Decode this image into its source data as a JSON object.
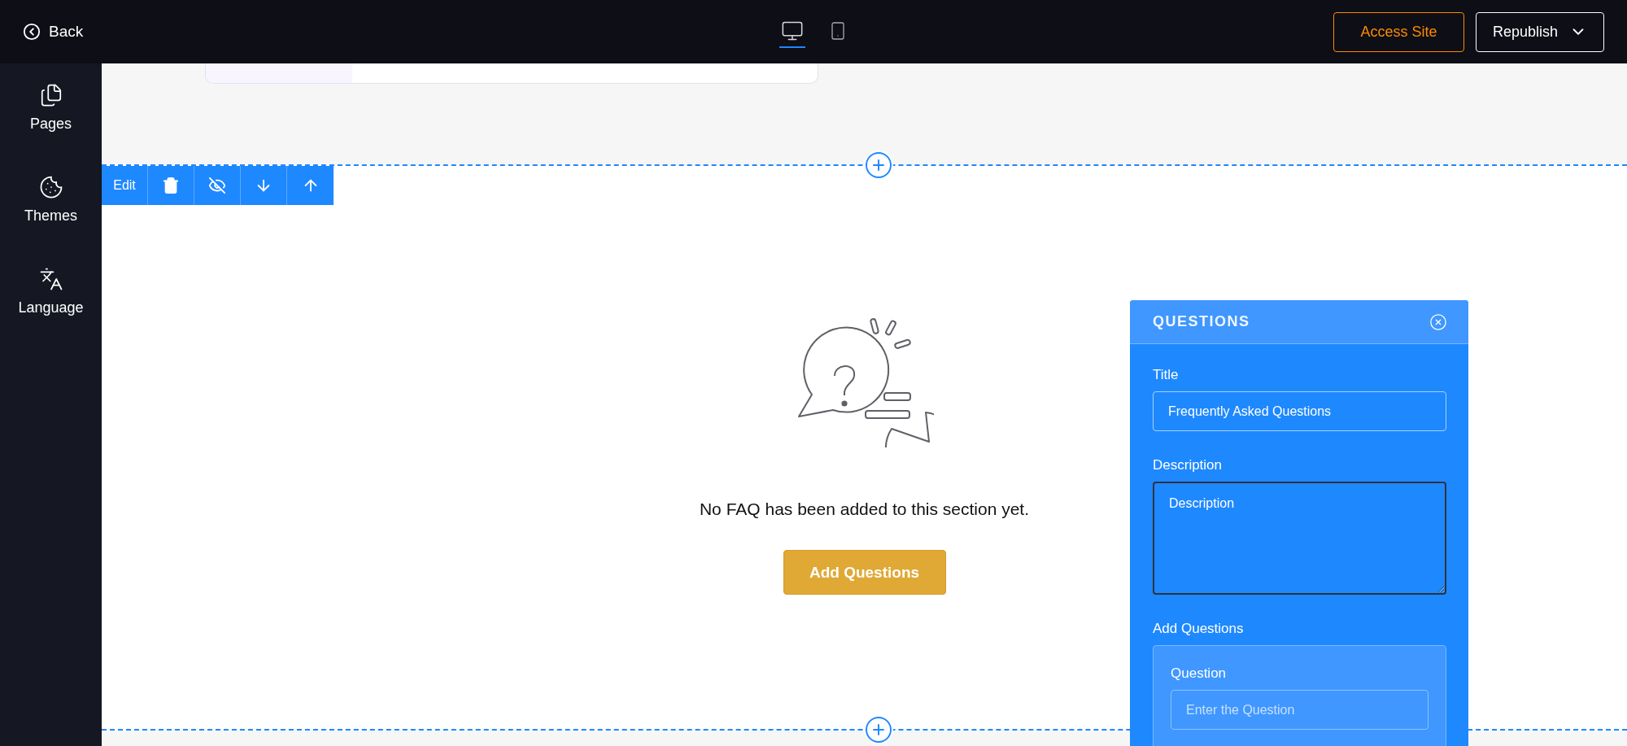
{
  "topbar": {
    "back": "Back",
    "devices": [
      {
        "kind": "desktop",
        "selected": true
      },
      {
        "kind": "mobile",
        "selected": false
      }
    ],
    "access_site": "Access Site",
    "republish": "Republish"
  },
  "sidebar": {
    "items": [
      {
        "kind": "pages",
        "label": "Pages"
      },
      {
        "kind": "themes",
        "label": "Themes"
      },
      {
        "kind": "language",
        "label": "Language"
      }
    ]
  },
  "section_toolbar": {
    "edit": "Edit",
    "actions": [
      {
        "kind": "delete"
      },
      {
        "kind": "hide"
      },
      {
        "kind": "move_down"
      },
      {
        "kind": "move_up"
      }
    ]
  },
  "empty_state": {
    "message": "No FAQ has been added to this section yet.",
    "button": "Add Questions"
  },
  "panel": {
    "title": "QUESTIONS",
    "fields": [
      {
        "kind": "input",
        "label": "Title",
        "value": "Frequently Asked Questions"
      },
      {
        "kind": "textarea",
        "label": "Description",
        "value": "Description"
      }
    ],
    "add_questions": {
      "label": "Add Questions",
      "question": {
        "label": "Question",
        "placeholder": "Enter the Question"
      }
    }
  }
}
